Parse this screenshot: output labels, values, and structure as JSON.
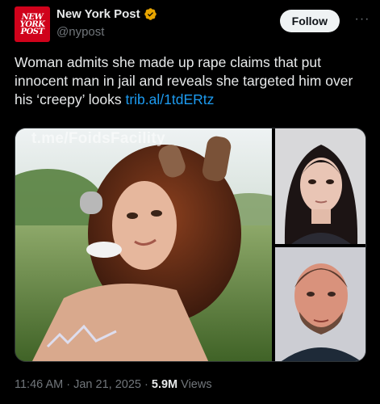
{
  "account": {
    "logo_text": [
      "NEW",
      "YORK",
      "POST"
    ],
    "display_name": "New York Post",
    "handle": "@nypost",
    "verified_icon": "verified-badge-icon",
    "verified_color": "#e8a500"
  },
  "actions": {
    "follow_label": "Follow",
    "more_label": "···"
  },
  "tweet": {
    "text": "Woman admits she made up rape claims that put innocent man in jail and reveals she targeted him over his ‘creepy’ looks ",
    "link": "trib.al/1tdERtz"
  },
  "media": {
    "watermark": "t.me/FoidsFacility",
    "images": [
      {
        "description_icon": "main-photo"
      },
      {
        "description_icon": "mugshot-woman"
      },
      {
        "description_icon": "mugshot-man"
      }
    ]
  },
  "meta": {
    "time": "11:46 AM",
    "separator": "·",
    "date": "Jan 21, 2025",
    "views_count": "5.9M",
    "views_label": "Views"
  },
  "colors": {
    "background": "#000000",
    "text": "#e7e9ea",
    "secondary": "#71767b",
    "link": "#1d9bf0",
    "brand_red": "#d0021b"
  }
}
